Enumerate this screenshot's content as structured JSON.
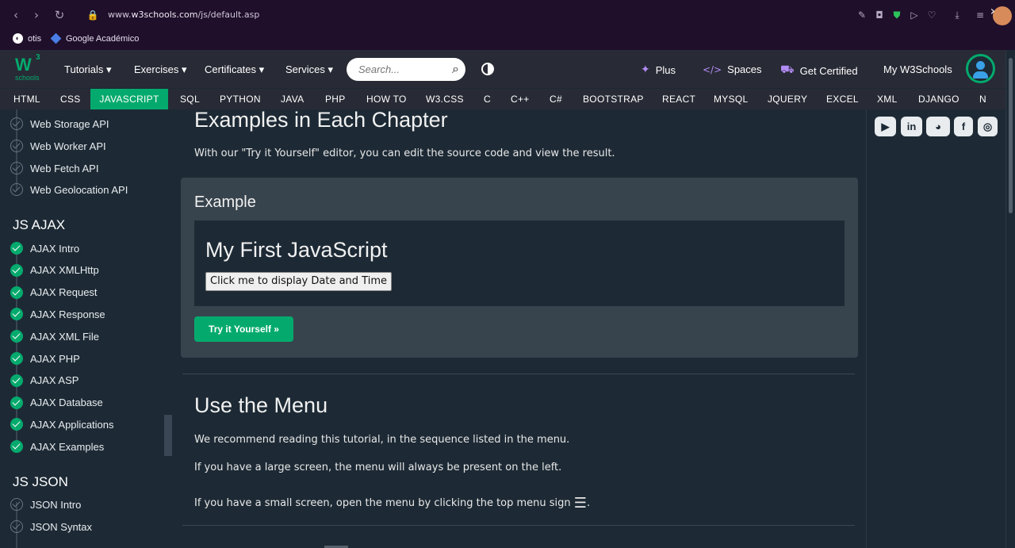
{
  "browser": {
    "url_prefix": "www.",
    "url_domain": "w3schools.com",
    "url_path": "/js/default.asp",
    "bookmarks": [
      "otis",
      "Google Académico"
    ]
  },
  "topnav": {
    "logo_top": "W",
    "logo_sup": "3",
    "logo_bottom": "schools",
    "menus": [
      "Tutorials ▾",
      "Exercises ▾",
      "Certificates ▾",
      "Services ▾"
    ],
    "search_placeholder": "Search...",
    "plus": "Plus",
    "spaces": "Spaces",
    "get_certified": "Get Certified",
    "my_w3schools": "My W3Schools"
  },
  "subnav": {
    "items": [
      "HTML",
      "CSS",
      "JAVASCRIPT",
      "SQL",
      "PYTHON",
      "JAVA",
      "PHP",
      "HOW TO",
      "W3.CSS",
      "C",
      "C++",
      "C#",
      "BOOTSTRAP",
      "REACT",
      "MYSQL",
      "JQUERY",
      "EXCEL",
      "XML",
      "DJANGO",
      "N"
    ],
    "active": "JAVASCRIPT"
  },
  "sidebar": {
    "web_api_items": [
      "Web Storage API",
      "Web Worker API",
      "Web Fetch API",
      "Web Geolocation API"
    ],
    "ajax_heading": "JS AJAX",
    "ajax_items": [
      "AJAX Intro",
      "AJAX XMLHttp",
      "AJAX Request",
      "AJAX Response",
      "AJAX XML File",
      "AJAX PHP",
      "AJAX ASP",
      "AJAX Database",
      "AJAX Applications",
      "AJAX Examples"
    ],
    "json_heading": "JS JSON",
    "json_items": [
      "JSON Intro",
      "JSON Syntax"
    ]
  },
  "main": {
    "examples_heading": "Examples in Each Chapter",
    "examples_text": "With our \"Try it Yourself\" editor, you can edit the source code and view the result.",
    "example_title": "Example",
    "example_heading": "My First JavaScript",
    "example_button": "Click me to display Date and Time",
    "try_button": "Try it Yourself »",
    "menu_heading": "Use the Menu",
    "menu_p1": "We recommend reading this tutorial, in the sequence listed in the menu.",
    "menu_p2": "If you have a large screen, the menu will always be present on the left.",
    "menu_p3": "If you have a small screen, open the menu by clicking the top menu sign",
    "menu_p3_icon": "☰",
    "menu_p3_end": "."
  },
  "social": [
    "youtube-icon",
    "linkedin-icon",
    "discord-icon",
    "facebook-icon",
    "instagram-icon"
  ],
  "colors": {
    "accent": "#04aa6d",
    "bg": "#1d2a35",
    "nav": "#282a35"
  }
}
